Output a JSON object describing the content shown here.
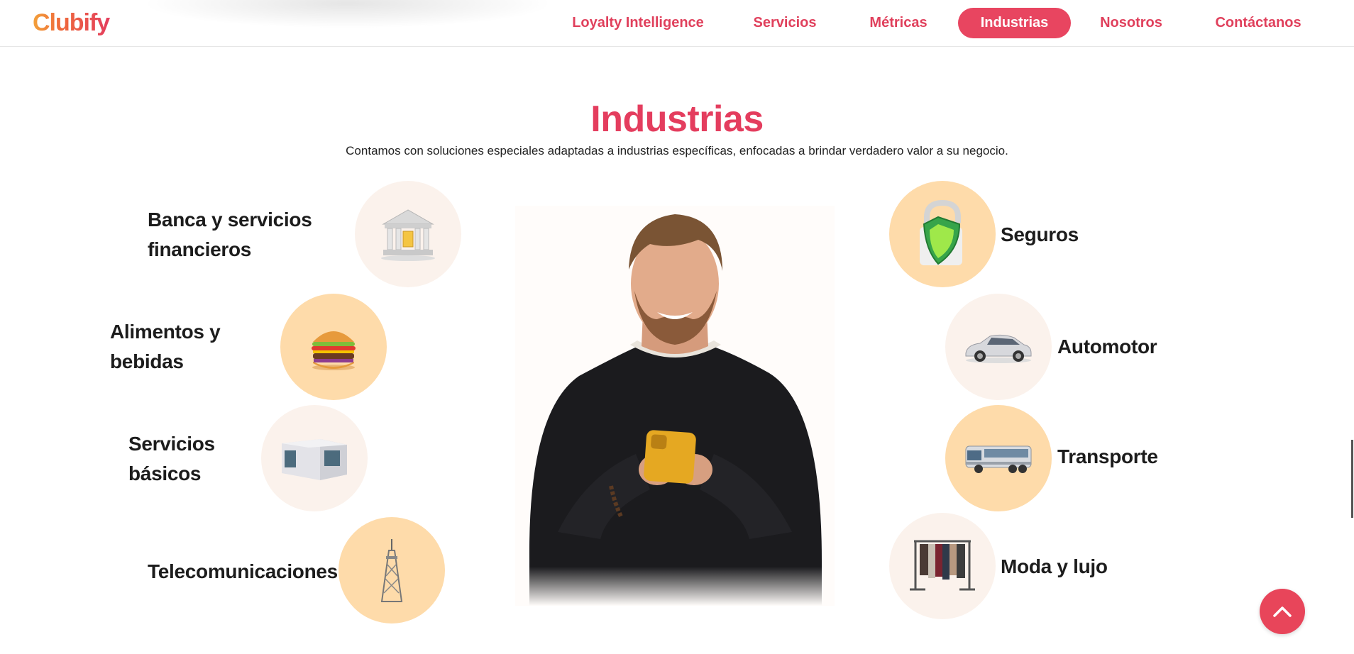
{
  "brand": {
    "name": "Clubify",
    "accent": "#e8455a",
    "orange": "#f08a2c"
  },
  "nav": {
    "items": [
      {
        "label": "Loyalty Intelligence",
        "active": false
      },
      {
        "label": "Servicios",
        "active": false
      },
      {
        "label": "Métricas",
        "active": false
      },
      {
        "label": "Industrias",
        "active": true
      },
      {
        "label": "Nosotros",
        "active": false
      },
      {
        "label": "Contáctanos",
        "active": false
      }
    ]
  },
  "section": {
    "title": "Industrias",
    "subtitle": "Contamos con soluciones especiales adaptadas a industrias específicas, enfocadas a brindar verdadero valor a su negocio."
  },
  "industries": {
    "left": [
      {
        "line1": "Banca y servicios",
        "line2": "financieros",
        "icon": "bank-icon"
      },
      {
        "line1": "Alimentos y",
        "line2": "bebidas",
        "icon": "burger-icon"
      },
      {
        "line1": "Servicios",
        "line2": "básicos",
        "icon": "building-icon"
      },
      {
        "line1": "Telecomunicaciones",
        "line2": "",
        "icon": "tower-icon"
      }
    ],
    "right": [
      {
        "label": "Seguros",
        "icon": "shield-lock-icon"
      },
      {
        "label": "Automotor",
        "icon": "car-icon"
      },
      {
        "label": "Transporte",
        "icon": "bus-icon"
      },
      {
        "label": "Moda y lujo",
        "icon": "clothes-rack-icon"
      }
    ]
  },
  "center_image": {
    "icon": "person-with-phone-icon"
  },
  "scroll_top": {
    "icon": "chevron-up-icon"
  }
}
